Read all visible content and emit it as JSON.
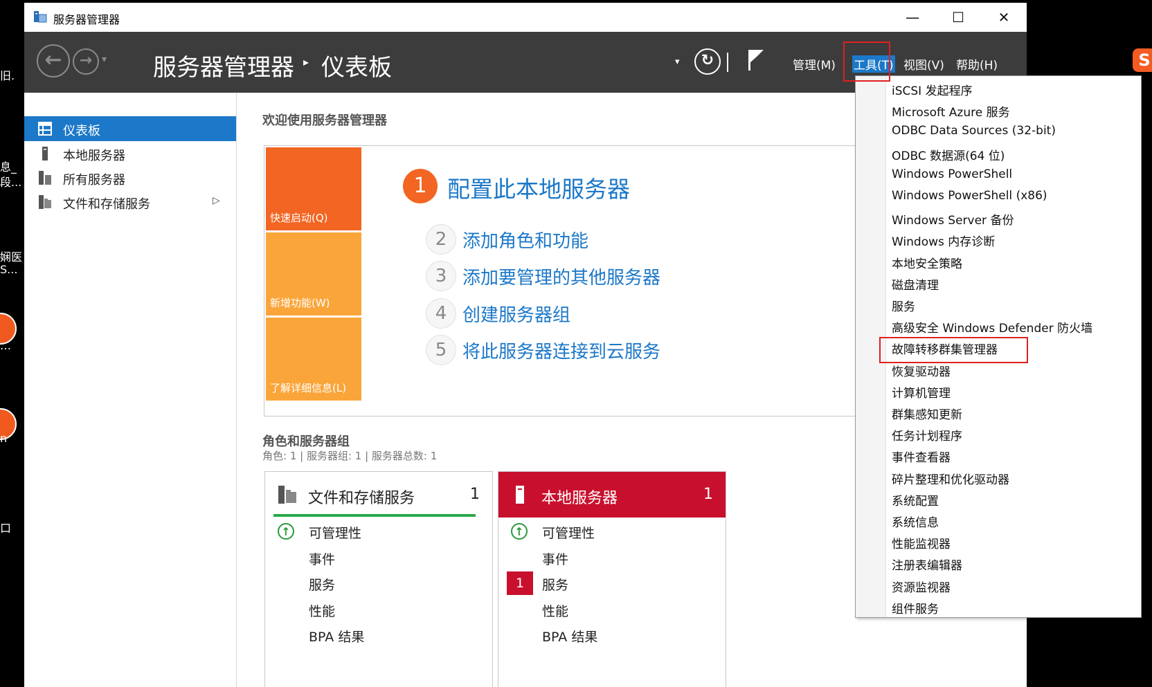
{
  "desktop": {
    "left_fragments": [
      "旧.",
      "息_",
      "段...",
      "娴医",
      "S...",
      "…",
      "n",
      "口"
    ]
  },
  "window": {
    "title": "服务器管理器",
    "controls": {
      "minimize": "—",
      "maximize": "☐",
      "close": "✕"
    }
  },
  "header": {
    "breadcrumb_root": "服务器管理器",
    "breadcrumb_sep": "▸",
    "breadcrumb_page": "仪表板",
    "menus": [
      {
        "label": "管理(M)"
      },
      {
        "label": "工具(T)"
      },
      {
        "label": "视图(V)"
      },
      {
        "label": "帮助(H)"
      }
    ]
  },
  "sidebar": {
    "items": [
      {
        "label": "仪表板"
      },
      {
        "label": "本地服务器"
      },
      {
        "label": "所有服务器"
      },
      {
        "label": "文件和存储服务"
      }
    ]
  },
  "welcome": {
    "title": "欢迎使用服务器管理器",
    "tiles": [
      {
        "label": "快速启动(Q)",
        "color": "#f26522"
      },
      {
        "label": "新增功能(W)",
        "color": "#faa53a"
      },
      {
        "label": "了解详细信息(L)",
        "color": "#faa53a"
      }
    ],
    "step1": {
      "num": "1",
      "label": "配置此本地服务器"
    },
    "steps": [
      {
        "num": "2",
        "label": "添加角色和功能"
      },
      {
        "num": "3",
        "label": "添加要管理的其他服务器"
      },
      {
        "num": "4",
        "label": "创建服务器组"
      },
      {
        "num": "5",
        "label": "将此服务器连接到云服务"
      }
    ]
  },
  "roles": {
    "title": "角色和服务器组",
    "summary": "角色: 1 | 服务器组: 1 | 服务器总数: 1",
    "cards": [
      {
        "title": "文件和存储服务",
        "count": "1",
        "rows": [
          "可管理性",
          "事件",
          "服务",
          "性能",
          "BPA 结果"
        ],
        "accent": "#2aa84a"
      },
      {
        "title": "本地服务器",
        "count": "1",
        "rows": [
          "可管理性",
          "事件",
          "服务",
          "性能",
          "BPA 结果"
        ],
        "service_badge": "1",
        "accent": "#c8102e"
      }
    ]
  },
  "tools_menu": {
    "items": [
      "iSCSI 发起程序",
      "Microsoft Azure 服务",
      "ODBC Data Sources (32-bit)",
      "ODBC 数据源(64 位)",
      "Windows PowerShell",
      "Windows PowerShell (x86)",
      "Windows Server 备份",
      "Windows 内存诊断",
      "本地安全策略",
      "磁盘清理",
      "服务",
      "高级安全 Windows Defender 防火墙",
      "故障转移群集管理器",
      "恢复驱动器",
      "计算机管理",
      "群集感知更新",
      "任务计划程序",
      "事件查看器",
      "碎片整理和优化驱动器",
      "系统配置",
      "系统信息",
      "性能监视器",
      "注册表编辑器",
      "资源监视器",
      "组件服务"
    ]
  },
  "colors": {
    "header_bg": "#3c3c3c",
    "selection_blue": "#1c78c8",
    "link_blue": "#1c78c8",
    "highlight_red": "#e02020"
  }
}
